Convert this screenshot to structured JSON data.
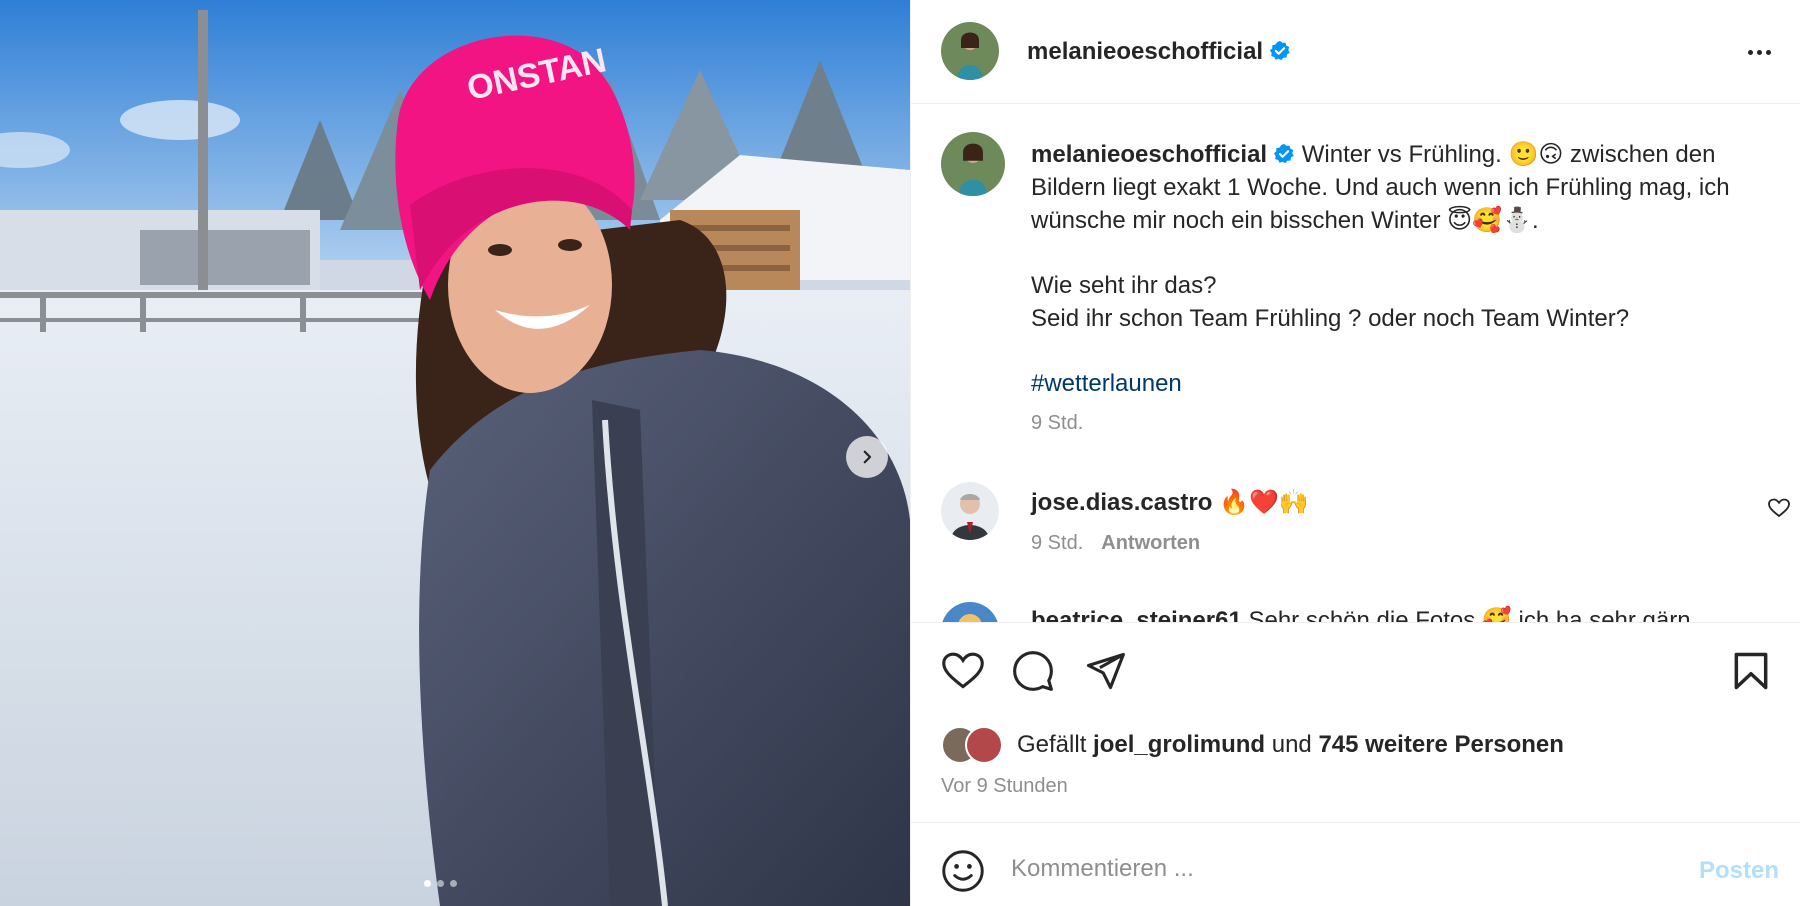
{
  "media": {
    "description_icon": "next-arrow-icon",
    "carousel": {
      "count": 3,
      "active": 1
    }
  },
  "post": {
    "author": "melanieoeschofficial",
    "caption_text_1": "Winter vs Frühling. 🙂🙃 zwischen den Bildern liegt exakt 1 Woche. Und auch wenn ich Frühling mag, ich wünsche mir noch ein bisschen Winter 😇🥰⛄.",
    "caption_text_2": "Wie seht ihr das?",
    "caption_text_3": "Seid ihr schon Team Frühling ? oder noch Team Winter?",
    "hashtag": "#wetterlaunen",
    "caption_time": "9 Std."
  },
  "comments": [
    {
      "user": "jose.dias.castro",
      "text": "🔥❤️🙌",
      "time": "9 Std.",
      "reply_label": "Antworten"
    },
    {
      "user": "beatrice_steiner61",
      "text": "Sehr schön die Fotos 🥰 ich ha sehr gärn"
    }
  ],
  "likes": {
    "prefix": "Gefällt",
    "user": "joel_grolimund",
    "and": "und",
    "others": "745 weitere Personen"
  },
  "post_time": "Vor 9 Stunden",
  "composer": {
    "placeholder": "Kommentieren ...",
    "post_label": "Posten"
  },
  "colors": {
    "accent": "#0095f6",
    "verified": "#0095f6",
    "hashtag": "#00376b",
    "muted": "#8e8e8e",
    "post_disabled": "#b2dffc"
  }
}
